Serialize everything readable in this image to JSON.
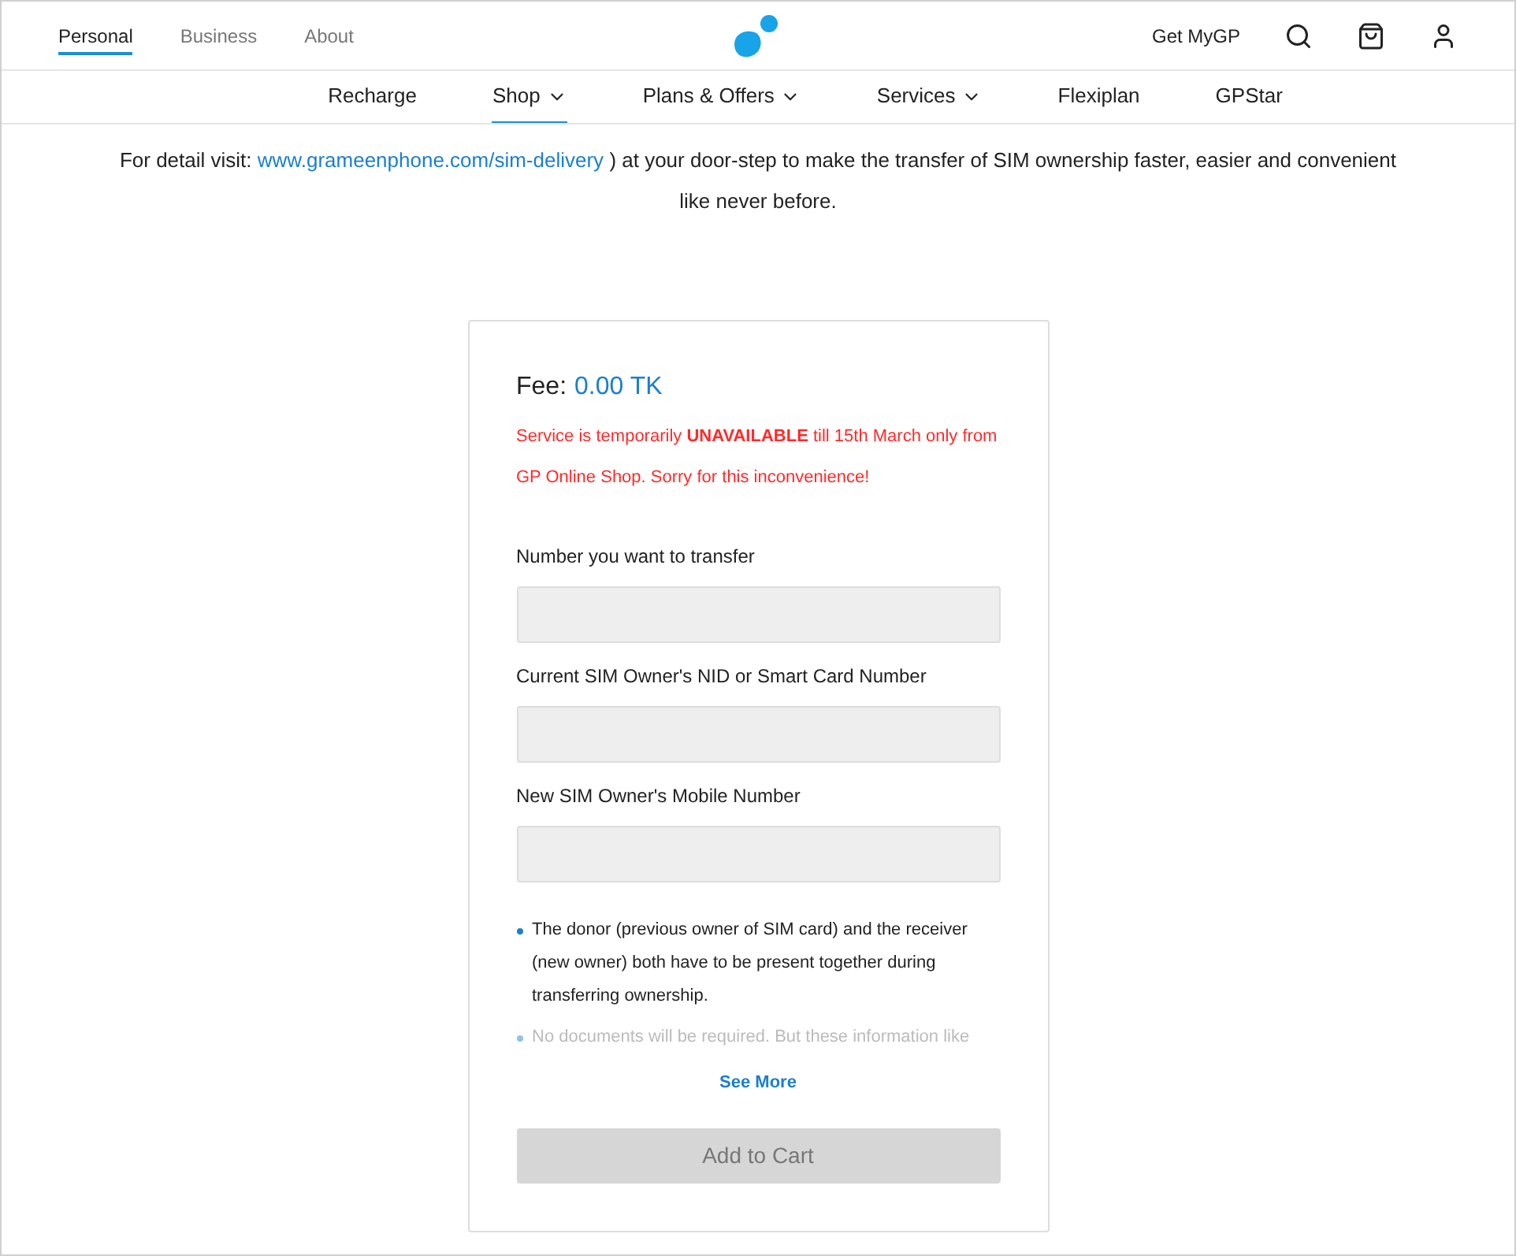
{
  "top_tabs": [
    {
      "label": "Personal",
      "selected": true
    },
    {
      "label": "Business",
      "selected": false
    },
    {
      "label": "About",
      "selected": false
    }
  ],
  "header_link": "Get MyGP",
  "nav": [
    {
      "label": "Recharge",
      "has_menu": false,
      "selected": false
    },
    {
      "label": "Shop",
      "has_menu": true,
      "selected": true
    },
    {
      "label": "Plans & Offers",
      "has_menu": true,
      "selected": false
    },
    {
      "label": "Services",
      "has_menu": true,
      "selected": false
    },
    {
      "label": "Flexiplan",
      "has_menu": false,
      "selected": false
    },
    {
      "label": "GPStar",
      "has_menu": false,
      "selected": false
    }
  ],
  "intro": {
    "prefix": "For detail visit:",
    "link": "www.grameenphone.com/sim-delivery",
    "suffix": ") at your door-step to make the transfer of SIM ownership faster, easier and convenient like never before."
  },
  "card": {
    "fee_label": "Fee:",
    "fee_value": "0.00 TK",
    "notice": "Service is temporarily **UNAVAILABLE** till 15th March only from GP Online Shop. Sorry for this inconvenience!",
    "fields": [
      {
        "label": "Number you want to transfer"
      },
      {
        "label": "Current SIM Owner's NID or Smart Card Number"
      },
      {
        "label": "New SIM Owner's Mobile Number"
      }
    ],
    "notes": [
      {
        "text": "The donor (previous owner of SIM card) and the receiver (new owner) both have to be present together during transferring ownership.",
        "faded": false
      },
      {
        "text": "No documents will be required. But these information like",
        "faded": true
      }
    ],
    "see_more": "See More",
    "button": {
      "label": "Add to Cart",
      "disabled": true
    }
  }
}
